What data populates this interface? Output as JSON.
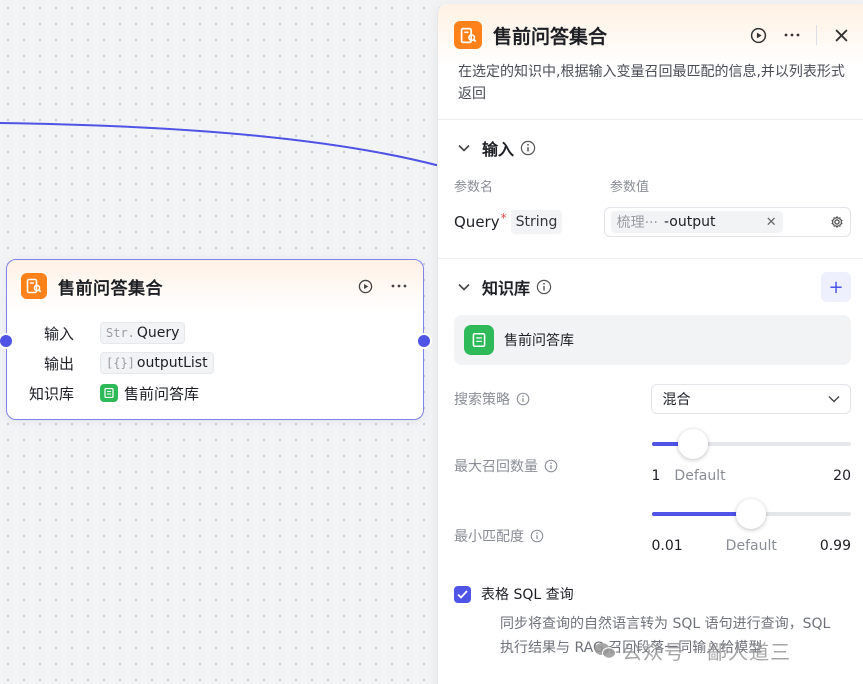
{
  "node": {
    "title": "售前问答集合",
    "rows": [
      {
        "label": "输入",
        "type_prefix": "Str.",
        "value": "Query"
      },
      {
        "label": "输出",
        "type_prefix": "[{}]",
        "value": "outputList"
      },
      {
        "label": "知识库",
        "value": "售前问答库"
      }
    ]
  },
  "panel": {
    "title": "售前问答集合",
    "description": "在选定的知识中,根据输入变量召回最匹配的信息,并以列表形式返回",
    "input_section": {
      "title": "输入",
      "col_name": "参数名",
      "col_value": "参数值",
      "param_name": "Query",
      "param_required_mark": "*",
      "param_type": "String",
      "ref_source": "梳理···",
      "ref_output": "-output"
    },
    "kb_section": {
      "title": "知识库",
      "add_label": "+",
      "kb_name": "售前问答库"
    },
    "search_strategy": {
      "label": "搜索策略",
      "value": "混合"
    },
    "max_recall": {
      "label": "最大召回数量",
      "min": "1",
      "default_label": "Default",
      "max": "20",
      "fraction": 0.21
    },
    "min_match": {
      "label": "最小匹配度",
      "min": "0.01",
      "default_label": "Default",
      "max": "0.99",
      "fraction": 0.5
    },
    "sql": {
      "label": "表格 SQL 查询",
      "checked": true,
      "description": "同步将查询的自然语言转为 SQL 语句进行查询，SQL 执行结果与 RAG 召回段落一同输入给模型"
    }
  },
  "watermark": "公众号 · 鄙人道三",
  "colors": {
    "accent": "#4f53e6",
    "app_icon": "#ff811a",
    "kb_icon": "#2fba5a"
  }
}
